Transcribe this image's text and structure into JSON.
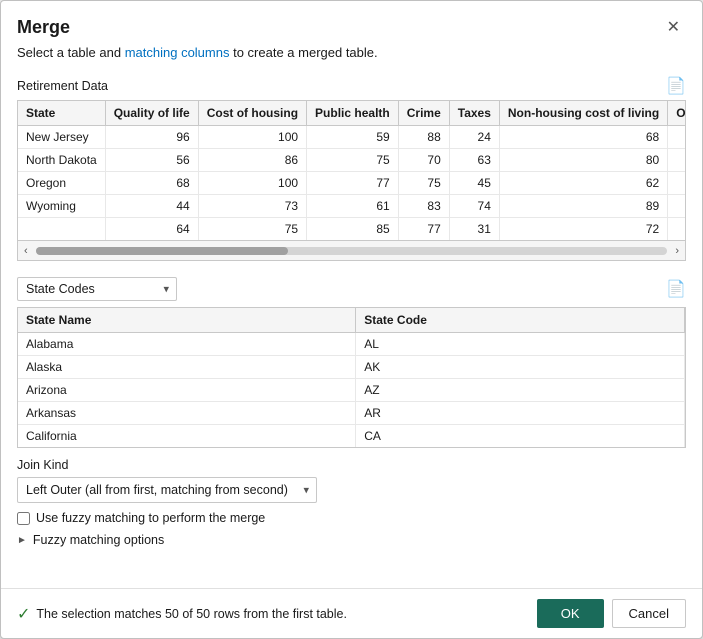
{
  "dialog": {
    "title": "Merge",
    "close_label": "✕",
    "subtitle_text": "Select a table and matching columns to create a merged table.",
    "subtitle_link": "matching columns"
  },
  "first_table": {
    "section_label": "Retirement Data",
    "doc_icon": "📄",
    "columns": [
      "State",
      "Quality of life",
      "Cost of housing",
      "Public health",
      "Crime",
      "Taxes",
      "Non-housing cost of living",
      "Ov"
    ],
    "rows": [
      [
        "New Jersey",
        "96",
        "100",
        "59",
        "88",
        "24",
        "68",
        ""
      ],
      [
        "North Dakota",
        "56",
        "86",
        "75",
        "70",
        "63",
        "80",
        ""
      ],
      [
        "Oregon",
        "68",
        "100",
        "77",
        "75",
        "45",
        "62",
        ""
      ],
      [
        "Wyoming",
        "44",
        "73",
        "61",
        "83",
        "74",
        "89",
        ""
      ],
      [
        "",
        "64",
        "75",
        "85",
        "77",
        "31",
        "72",
        ""
      ]
    ]
  },
  "second_table_dropdown": {
    "options": [
      "State Codes"
    ],
    "selected": "State Codes",
    "doc_icon": "📄"
  },
  "second_table": {
    "columns": [
      "State Name",
      "State Code"
    ],
    "rows": [
      [
        "Alabama",
        "AL"
      ],
      [
        "Alaska",
        "AK"
      ],
      [
        "Arizona",
        "AZ"
      ],
      [
        "Arkansas",
        "AR"
      ],
      [
        "California",
        "CA"
      ]
    ]
  },
  "join_kind": {
    "label": "Join Kind",
    "options": [
      "Left Outer (all from first, matching from second)"
    ],
    "selected": "Left Outer (all from first, matching from second)"
  },
  "fuzzy_matching": {
    "checkbox_label": "Use fuzzy matching to perform the merge",
    "options_label": "Fuzzy matching options"
  },
  "footer": {
    "status_text": "The selection matches 50 of 50 rows from the first table.",
    "ok_label": "OK",
    "cancel_label": "Cancel"
  }
}
